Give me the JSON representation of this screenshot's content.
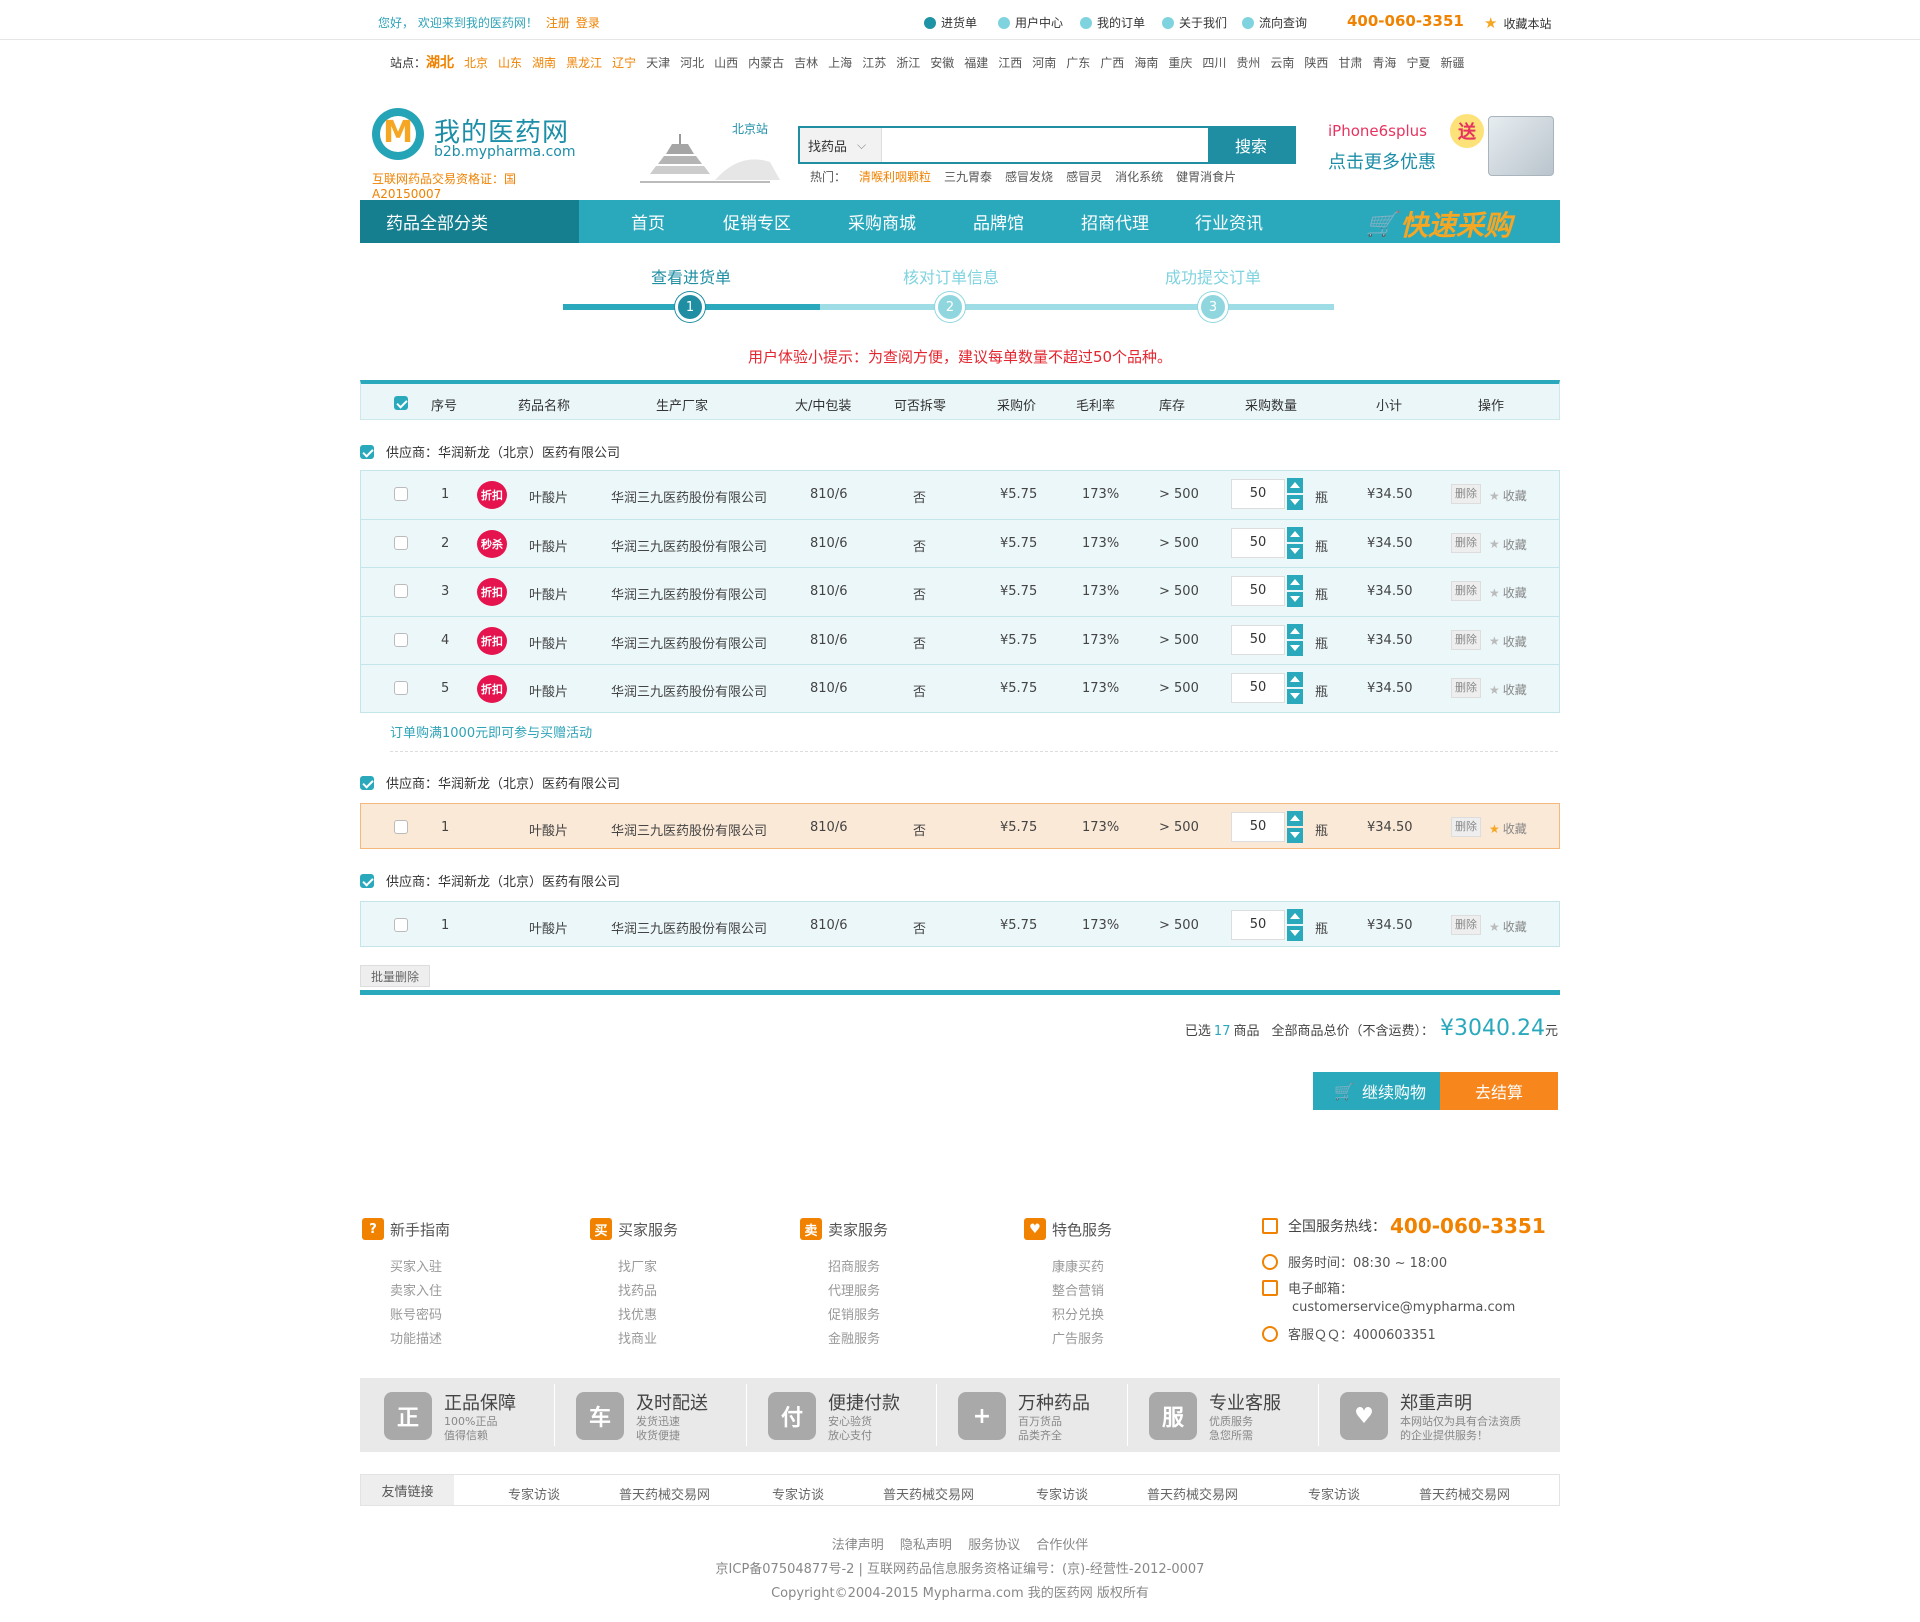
{
  "topbar": {
    "welcome": "您好， 欢迎来到我的医药网！",
    "register": "注册",
    "login": "登录",
    "links": [
      "进货单",
      "用户中心",
      "我的订单",
      "关于我们",
      "流向查询"
    ],
    "hotline": "400-060-3351",
    "favorite": "收藏本站"
  },
  "stations": {
    "label": "站点：",
    "current": "湖北",
    "highlighted": [
      "北京",
      "山东",
      "湖南",
      "黑龙江",
      "辽宁"
    ],
    "others": [
      "天津",
      "河北",
      "山西",
      "内蒙古",
      "吉林",
      "上海",
      "江苏",
      "浙江",
      "安徽",
      "福建",
      "江西",
      "河南",
      "广东",
      "广西",
      "海南",
      "重庆",
      "四川",
      "贵州",
      "云南",
      "陕西",
      "甘肃",
      "青海",
      "宁夏",
      "新疆"
    ]
  },
  "header": {
    "logo_mark": "M",
    "logo_name": "我的医药网",
    "logo_domain": "b2b.mypharma.com",
    "license": "互联网药品交易资格证：国A20150007",
    "city": "北京站",
    "search_select": "找药品",
    "search_button": "搜索",
    "hot_label": "热门：",
    "hot_words": [
      "清喉利咽颗粒",
      "三九胃泰",
      "感冒发烧",
      "感冒灵",
      "消化系统",
      "健胃消食片"
    ],
    "promo_line1": "iPhone6splus",
    "promo_line2": "点击更多优惠",
    "promo_badge": "送"
  },
  "nav": {
    "all": "药品全部分类",
    "items": [
      "首页",
      "促销专区",
      "采购商城",
      "品牌馆",
      "招商代理",
      "行业资讯"
    ],
    "quick": "快速采购"
  },
  "steps": [
    {
      "label": "查看进货单",
      "num": "1"
    },
    {
      "label": "核对订单信息",
      "num": "2"
    },
    {
      "label": "成功提交订单",
      "num": "3"
    }
  ],
  "tip": "用户体验小提示：为查阅方便，建议每单数量不超过50个品种。",
  "table": {
    "headers": [
      "序号",
      "药品名称",
      "生产厂家",
      "大/中包装",
      "可否拆零",
      "采购价",
      "毛利率",
      "库存",
      "采购数量",
      "小计",
      "操作"
    ]
  },
  "groups": [
    {
      "supplier": "供应商：华润新龙（北京）医药有限公司",
      "rows": [
        {
          "no": "1",
          "tag": "折扣",
          "name": "叶酸片",
          "maker": "华润三九医药股份有限公司",
          "pack": "810/6",
          "split": "否",
          "price": "¥5.75",
          "margin": "173%",
          "stock": "> 500",
          "qty": "50",
          "unit": "瓶",
          "subtotal": "¥34.50",
          "del": "删除",
          "fav": "收藏"
        },
        {
          "no": "2",
          "tag": "秒杀",
          "name": "叶酸片",
          "maker": "华润三九医药股份有限公司",
          "pack": "810/6",
          "split": "否",
          "price": "¥5.75",
          "margin": "173%",
          "stock": "> 500",
          "qty": "50",
          "unit": "瓶",
          "subtotal": "¥34.50",
          "del": "删除",
          "fav": "收藏"
        },
        {
          "no": "3",
          "tag": "折扣",
          "name": "叶酸片",
          "maker": "华润三九医药股份有限公司",
          "pack": "810/6",
          "split": "否",
          "price": "¥5.75",
          "margin": "173%",
          "stock": "> 500",
          "qty": "50",
          "unit": "瓶",
          "subtotal": "¥34.50",
          "del": "删除",
          "fav": "收藏"
        },
        {
          "no": "4",
          "tag": "折扣",
          "name": "叶酸片",
          "maker": "华润三九医药股份有限公司",
          "pack": "810/6",
          "split": "否",
          "price": "¥5.75",
          "margin": "173%",
          "stock": "> 500",
          "qty": "50",
          "unit": "瓶",
          "subtotal": "¥34.50",
          "del": "删除",
          "fav": "收藏"
        },
        {
          "no": "5",
          "tag": "折扣",
          "name": "叶酸片",
          "maker": "华润三九医药股份有限公司",
          "pack": "810/6",
          "split": "否",
          "price": "¥5.75",
          "margin": "173%",
          "stock": "> 500",
          "qty": "50",
          "unit": "瓶",
          "subtotal": "¥34.50",
          "del": "删除",
          "fav": "收藏"
        }
      ],
      "note": "订单购满1000元即可参与买赠活动"
    },
    {
      "supplier": "供应商：华润新龙（北京）医药有限公司",
      "rows": [
        {
          "no": "1",
          "tag": "",
          "name": "叶酸片",
          "maker": "华润三九医药股份有限公司",
          "pack": "810/6",
          "split": "否",
          "price": "¥5.75",
          "margin": "173%",
          "stock": "> 500",
          "qty": "50",
          "unit": "瓶",
          "subtotal": "¥34.50",
          "del": "删除",
          "fav": "收藏"
        }
      ]
    },
    {
      "supplier": "供应商：华润新龙（北京）医药有限公司",
      "rows": [
        {
          "no": "1",
          "tag": "",
          "name": "叶酸片",
          "maker": "华润三九医药股份有限公司",
          "pack": "810/6",
          "split": "否",
          "price": "¥5.75",
          "margin": "173%",
          "stock": "> 500",
          "qty": "50",
          "unit": "瓶",
          "subtotal": "¥34.50",
          "del": "删除",
          "fav": "收藏"
        }
      ]
    }
  ],
  "batch_delete": "批量删除",
  "summary": {
    "selected_prefix": "已选",
    "selected_count": "17",
    "selected_suffix": "商品",
    "total_label": "全部商品总价（不含运费）：",
    "total": "¥3040.24",
    "currency_suffix": "元"
  },
  "buttons": {
    "continue": "继续购物",
    "checkout": "去结算"
  },
  "footer": {
    "columns": [
      {
        "title": "新手指南",
        "icon": "?",
        "links": [
          "买家入驻",
          "卖家入住",
          "账号密码",
          "功能描述"
        ]
      },
      {
        "title": "买家服务",
        "icon": "买",
        "links": [
          "找厂家",
          "找药品",
          "找优惠",
          "找商业"
        ]
      },
      {
        "title": "卖家服务",
        "icon": "卖",
        "links": [
          "招商服务",
          "代理服务",
          "促销服务",
          "金融服务"
        ]
      },
      {
        "title": "特色服务",
        "icon": "♥",
        "links": [
          "康康买药",
          "整合营销",
          "积分兑换",
          "广告服务"
        ]
      }
    ],
    "service": {
      "hotline_label": "全国服务热线：",
      "hotline": "400-060-3351",
      "hours": "服务时间：08:30 ~ 18:00",
      "email_label": "电子邮箱：",
      "email": "customerservice@mypharma.com",
      "qq": "客服ＱＱ：4000603351"
    },
    "guarantees": [
      {
        "icon": "正",
        "title": "正品保障",
        "d1": "100%正品",
        "d2": "值得信赖"
      },
      {
        "icon": "车",
        "title": "及时配送",
        "d1": "发货迅速",
        "d2": "收货便捷"
      },
      {
        "icon": "付",
        "title": "便捷付款",
        "d1": "安心验货",
        "d2": "放心支付"
      },
      {
        "icon": "+",
        "title": "万种药品",
        "d1": "百万货品",
        "d2": "品类齐全"
      },
      {
        "icon": "服",
        "title": "专业客服",
        "d1": "优质服务",
        "d2": "急您所需"
      },
      {
        "icon": "♥",
        "title": "郑重声明",
        "d1": "本网站仅为具有合法资质",
        "d2": "的企业提供服务！"
      }
    ],
    "links_label": "友情链接",
    "friend_links": [
      "专家访谈",
      "普天药械交易网",
      "专家访谈",
      "普天药械交易网",
      "专家访谈",
      "普天药械交易网",
      "专家访谈",
      "普天药械交易网"
    ],
    "legal_links": [
      "法律声明",
      "隐私声明",
      "服务协议",
      "合作伙伴"
    ],
    "icp": "京ICP备07504877号-2 | 互联网药品信息服务资格证编号：(京)-经营性-2012-0007",
    "copyright": "Copyright©2004-2015 Mypharma.com 我的医药网 版权所有"
  }
}
